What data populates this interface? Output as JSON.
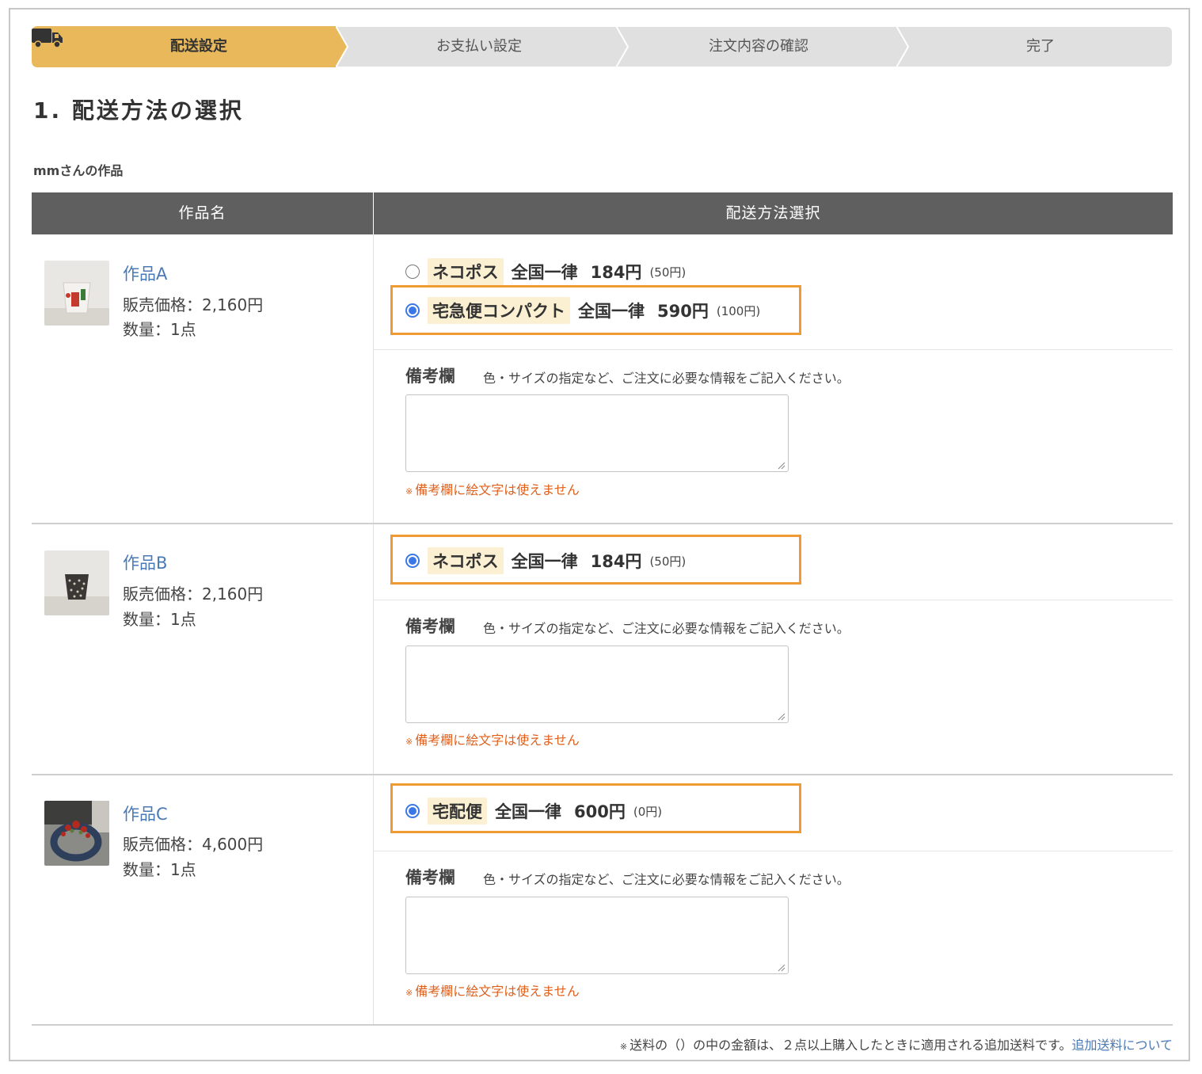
{
  "steps": [
    {
      "label": "配送設定",
      "active": true
    },
    {
      "label": "お支払い設定",
      "active": false
    },
    {
      "label": "注文内容の確認",
      "active": false
    },
    {
      "label": "完了",
      "active": false
    }
  ],
  "colors": {
    "active_step": "#e8b85a",
    "inactive_step": "#e0e0e0",
    "highlight": "#ef9a32",
    "link": "#4a7ab5",
    "warning": "#e1601c",
    "radio": "#3b78e7"
  },
  "heading": "1. 配送方法の選択",
  "seller": "mmさんの作品",
  "table": {
    "col_item": "作品名",
    "col_shipping": "配送方法選択"
  },
  "items": [
    {
      "name": "作品A",
      "price": "販売価格：2,160円",
      "qty": "数量：1点",
      "options": [
        {
          "method": "ネコポス",
          "area": "全国一律",
          "price": "184円",
          "extra": "(50円)",
          "selected": false
        },
        {
          "method": "宅急便コンパクト",
          "area": "全国一律",
          "price": "590円",
          "extra": "(100円)",
          "selected": true
        }
      ],
      "note_label": "備考欄",
      "note_hint": "色・サイズの指定など、ご注文に必要な情報をご記入ください。",
      "note_value": "",
      "warning": "備考欄に絵文字は使えません"
    },
    {
      "name": "作品B",
      "price": "販売価格：2,160円",
      "qty": "数量：1点",
      "options": [
        {
          "method": "ネコポス",
          "area": "全国一律",
          "price": "184円",
          "extra": "(50円)",
          "selected": true
        }
      ],
      "note_label": "備考欄",
      "note_hint": "色・サイズの指定など、ご注文に必要な情報をご記入ください。",
      "note_value": "",
      "warning": "備考欄に絵文字は使えません"
    },
    {
      "name": "作品C",
      "price": "販売価格：4,600円",
      "qty": "数量：1点",
      "options": [
        {
          "method": "宅配便",
          "area": "全国一律",
          "price": "600円",
          "extra": "(0円)",
          "selected": true
        }
      ],
      "note_label": "備考欄",
      "note_hint": "色・サイズの指定など、ご注文に必要な情報をご記入ください。",
      "note_value": "",
      "warning": "備考欄に絵文字は使えません"
    }
  ],
  "warning_mark": "※",
  "footer": {
    "mark": "※",
    "text": "送料の（）の中の金額は、２点以上購入したときに適用される追加送料です。",
    "link": "追加送料について"
  }
}
